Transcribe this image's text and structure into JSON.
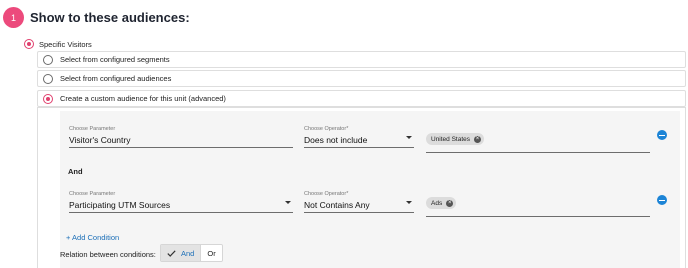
{
  "step": {
    "number": "1",
    "title": "Show to these audiences:"
  },
  "top_option": {
    "label": "Specific Visitors"
  },
  "options": [
    {
      "label": "Select from configured segments"
    },
    {
      "label": "Select from configured audiences"
    },
    {
      "label": "Create a custom audience for this unit (advanced)"
    }
  ],
  "conditions": [
    {
      "parameter_label": "Choose Parameter",
      "parameter_value": "Visitor's Country",
      "operator_label": "Choose Operator*",
      "operator_value": "Does not include",
      "chip": "United States"
    },
    {
      "parameter_label": "Choose Parameter",
      "parameter_value": "Participating UTM Sources",
      "operator_label": "Choose Operator*",
      "operator_value": "Not Contains Any",
      "chip": "Ads"
    }
  ],
  "joiner": "And",
  "add_condition": "+ Add Condition",
  "relation": {
    "label": "Relation between conditions:",
    "and": "And",
    "or": "Or",
    "selected": "And"
  },
  "colors": {
    "accent_pink": "#ec4a7c",
    "link_blue": "#1c6fb8",
    "remove_blue": "#1c84d6"
  }
}
